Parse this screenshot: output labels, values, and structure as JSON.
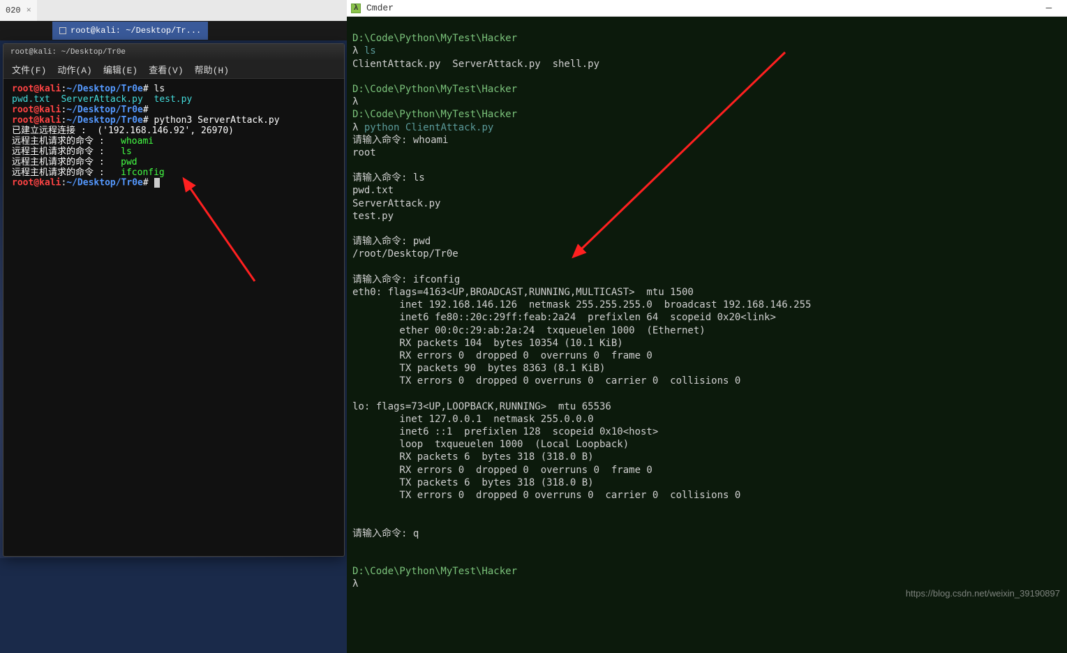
{
  "left": {
    "tab": {
      "label": "020"
    },
    "taskbar": {
      "title": "root@kali: ~/Desktop/Tr..."
    },
    "window": {
      "title": "root@kali: ~/Desktop/Tr0e",
      "menu": {
        "file": "文件(F)",
        "action": "动作(A)",
        "edit": "编辑(E)",
        "view": "查看(V)",
        "help": "帮助(H)"
      }
    },
    "terminal": {
      "prompt_user": "root@kali",
      "prompt_path": "~/Desktop/Tr0e",
      "cmd1": "ls",
      "ls_output": "pwd.txt  ServerAttack.py  test.py",
      "cmd2": "python3 ServerAttack.py",
      "conn_line": "已建立远程连接 :  ('192.168.146.92', 26970)",
      "req_prefix": "远程主机请求的命令 :",
      "cmds": {
        "whoami": "whoami",
        "ls": "ls",
        "pwd": "pwd",
        "ifconfig": "ifconfig"
      }
    }
  },
  "right": {
    "title": "Cmder",
    "path": "D:\\Code\\Python\\MyTest\\Hacker",
    "lambda": "λ",
    "cmd_ls": "ls",
    "ls_output": "ClientAttack.py  ServerAttack.py  shell.py",
    "cmd_py": "python ClientAttack.py",
    "input_prefix": "请输入命令:",
    "sessions": {
      "whoami": {
        "cmd": "whoami",
        "out": "root"
      },
      "ls": {
        "cmd": "ls",
        "out": "pwd.txt\nServerAttack.py\ntest.py"
      },
      "pwd": {
        "cmd": "pwd",
        "out": "/root/Desktop/Tr0e"
      },
      "ifconfig": {
        "cmd": "ifconfig",
        "out": "eth0: flags=4163<UP,BROADCAST,RUNNING,MULTICAST>  mtu 1500\n        inet 192.168.146.126  netmask 255.255.255.0  broadcast 192.168.146.255\n        inet6 fe80::20c:29ff:feab:2a24  prefixlen 64  scopeid 0x20<link>\n        ether 00:0c:29:ab:2a:24  txqueuelen 1000  (Ethernet)\n        RX packets 104  bytes 10354 (10.1 KiB)\n        RX errors 0  dropped 0  overruns 0  frame 0\n        TX packets 90  bytes 8363 (8.1 KiB)\n        TX errors 0  dropped 0 overruns 0  carrier 0  collisions 0\n\nlo: flags=73<UP,LOOPBACK,RUNNING>  mtu 65536\n        inet 127.0.0.1  netmask 255.0.0.0\n        inet6 ::1  prefixlen 128  scopeid 0x10<host>\n        loop  txqueuelen 1000  (Local Loopback)\n        RX packets 6  bytes 318 (318.0 B)\n        RX errors 0  dropped 0  overruns 0  frame 0\n        TX packets 6  bytes 318 (318.0 B)\n        TX errors 0  dropped 0 overruns 0  carrier 0  collisions 0"
      },
      "q": {
        "cmd": "q"
      }
    }
  },
  "watermark": "https://blog.csdn.net/weixin_39190897"
}
